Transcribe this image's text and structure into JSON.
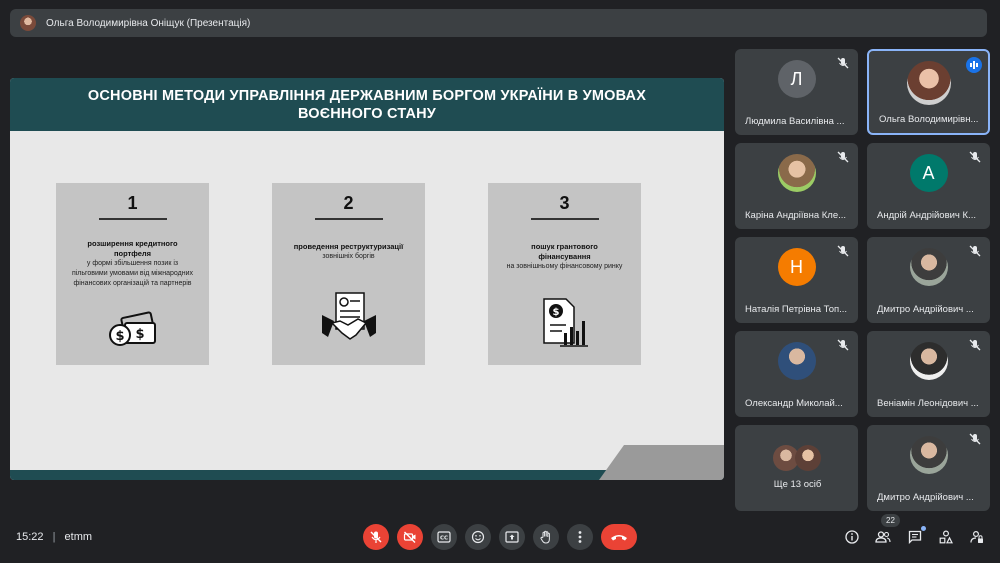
{
  "meeting": {
    "presenter_title": "Ольга Володимирівна Оніщук (Презентація)",
    "time": "15:22",
    "code": "etmm",
    "participant_count": "22"
  },
  "slide": {
    "title": "ОСНОВНІ МЕТОДИ УПРАВЛІННЯ ДЕРЖАВНИМ БОРГОМ УКРАЇНИ В УМОВАХ ВОЄННОГО СТАНУ",
    "cards": [
      {
        "number": "1",
        "bold": "розширення кредитного портфеля",
        "text": "у формі збільшення позик із пільговими умовами від міжнародних фінансових організацій та партнерів",
        "icon": "money-icon"
      },
      {
        "number": "2",
        "bold": "проведення реструктуризації",
        "text": "зовнішніх боргів",
        "icon": "handshake-contract-icon"
      },
      {
        "number": "3",
        "bold": "пошук грантового фінансування",
        "text": "на зовнішньому фінансовому ринку",
        "icon": "financial-report-icon"
      }
    ]
  },
  "participants": [
    {
      "name": "Людмила Василівна ...",
      "initial": "Л",
      "avatar_color": "#5f6368",
      "muted": true
    },
    {
      "name": "Ольга Володимирівн...",
      "initial": "",
      "avatar_color": "#8d6e63",
      "muted": false,
      "speaking": true
    },
    {
      "name": "Каріна Андріївна Кле...",
      "initial": "",
      "avatar_color": "#a1887f",
      "muted": true
    },
    {
      "name": "Андрій Андрійович К...",
      "initial": "А",
      "avatar_color": "#00796b",
      "muted": true
    },
    {
      "name": "Наталія Петрівна Топ...",
      "initial": "Н",
      "avatar_color": "#f57c00",
      "muted": true
    },
    {
      "name": "Дмитро Андрійович ...",
      "initial": "",
      "avatar_color": "#6d7a6f",
      "muted": true
    },
    {
      "name": "Олександр Миколай...",
      "initial": "",
      "avatar_color": "#4e6a8a",
      "muted": true
    },
    {
      "name": "Веніамін Леонідович ...",
      "initial": "",
      "avatar_color": "#e0e0e0",
      "muted": true
    },
    {
      "name": "Ще 13 осіб",
      "initial": "",
      "avatar_color": "#795548",
      "muted": false
    },
    {
      "name": "Дмитро Андрійович ...",
      "initial": "",
      "avatar_color": "#6d7a6f",
      "muted": true
    }
  ],
  "colors": {
    "accent_red": "#ea4335",
    "slide_header": "#1f4c52",
    "active_border": "#8ab4f8"
  }
}
